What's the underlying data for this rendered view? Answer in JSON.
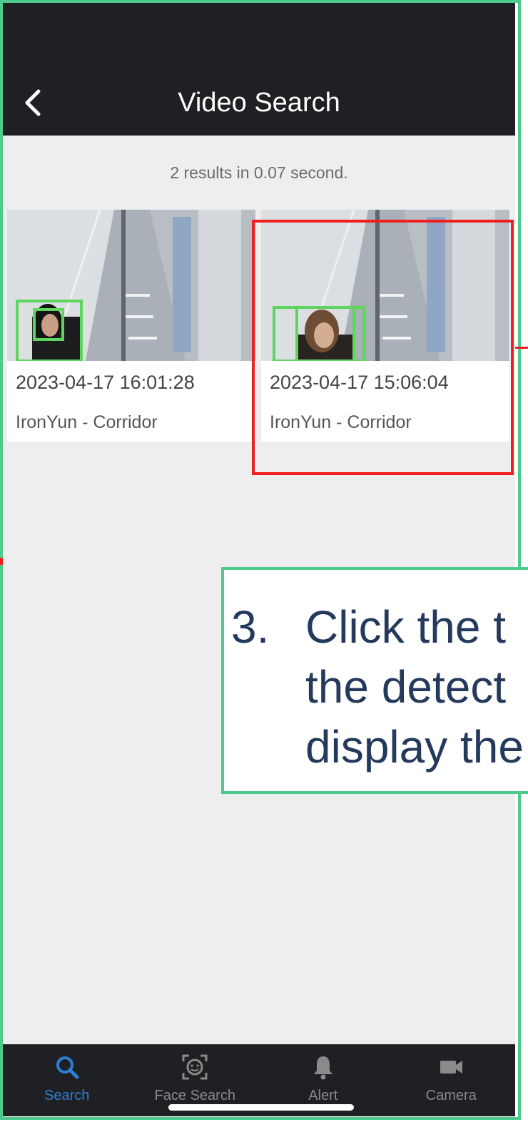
{
  "header": {
    "back_icon": "chevron-left-icon",
    "title": "Video Search"
  },
  "summary": "2 results in 0.07 second.",
  "results": [
    {
      "timestamp": "2023-04-17 16:01:28",
      "location": "IronYun - Corridor"
    },
    {
      "timestamp": "2023-04-17 15:06:04",
      "location": "IronYun - Corridor"
    }
  ],
  "tabs": [
    {
      "label": "Search",
      "icon": "search-icon",
      "active": true
    },
    {
      "label": "Face Search",
      "icon": "face-scan-icon",
      "active": false
    },
    {
      "label": "Alert",
      "icon": "bell-icon",
      "active": false
    },
    {
      "label": "Camera",
      "icon": "video-camera-icon",
      "active": false
    }
  ],
  "callout": {
    "number": "3.",
    "text": "Click the t\nthe detect\ndisplay the"
  },
  "colors": {
    "topbar": "#1f2023",
    "active_tab": "#2d7fd6",
    "frame": "#4ccb8c",
    "highlight": "#ee1f1f",
    "callout_text": "#24395c",
    "detection_box": "#5ed65e"
  }
}
